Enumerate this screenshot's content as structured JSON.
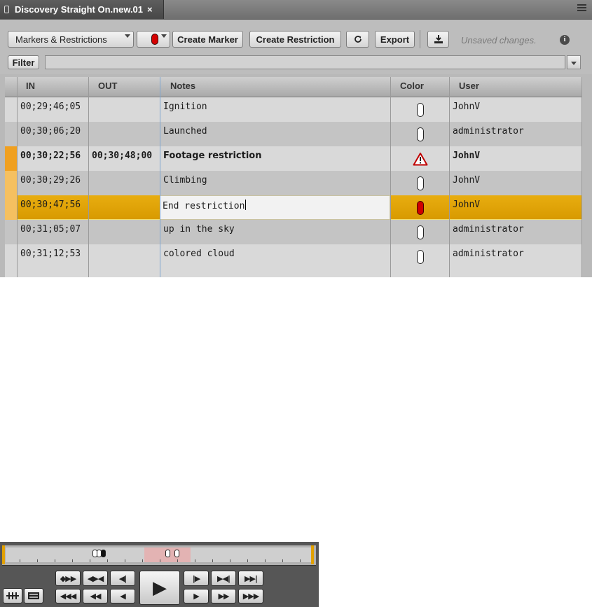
{
  "window": {
    "tab_title": "Discovery Straight On.new.01",
    "tab_close": "×"
  },
  "toolbar": {
    "view_select": "Markers & Restrictions",
    "marker_color": "#d40000",
    "create_marker": "Create Marker",
    "create_restriction": "Create Restriction",
    "export": "Export",
    "status": "Unsaved changes.",
    "info": "i"
  },
  "filter": {
    "button": "Filter",
    "value": ""
  },
  "table": {
    "columns": [
      "IN",
      "OUT",
      "Notes",
      "Color",
      "User"
    ],
    "rows": [
      {
        "in": "00;29;46;05",
        "out": "",
        "notes": "Ignition",
        "color": "white-marker",
        "user": "JohnV"
      },
      {
        "in": "00;30;06;20",
        "out": "",
        "notes": "Launched",
        "color": "white-marker",
        "user": "administrator"
      },
      {
        "in": "00;30;22;56",
        "out": "00;30;48;00",
        "notes": "Footage restriction",
        "color": "warning-triangle",
        "user": "JohnV"
      },
      {
        "in": "00;30;29;26",
        "out": "",
        "notes": "Climbing",
        "color": "white-marker",
        "user": "JohnV"
      },
      {
        "in": "00;30;47;56",
        "out": "",
        "notes": "End restriction",
        "color": "red-marker",
        "user": "JohnV"
      },
      {
        "in": "00;31;05;07",
        "out": "",
        "notes": "up in the sky",
        "color": "white-marker",
        "user": "administrator"
      },
      {
        "in": "00;31;12;53",
        "out": "",
        "notes": "colored cloud",
        "color": "white-marker",
        "user": "administrator"
      }
    ]
  },
  "colors": {
    "selected_row": "#e2a100",
    "restriction_gutter": "#f0a020",
    "restriction_range_gutter": "#f5c060",
    "warning": "#c00000"
  },
  "transport": {
    "buttons_top": [
      "◆▶▶",
      "◀▶◀",
      "◀|",
      "|▶",
      "▶◀|",
      "▶▶|"
    ],
    "buttons_bottom": [
      "◀◀◀",
      "◀◀",
      "◀",
      "▶",
      "▶▶",
      "▶▶▶"
    ],
    "play": "▶"
  }
}
